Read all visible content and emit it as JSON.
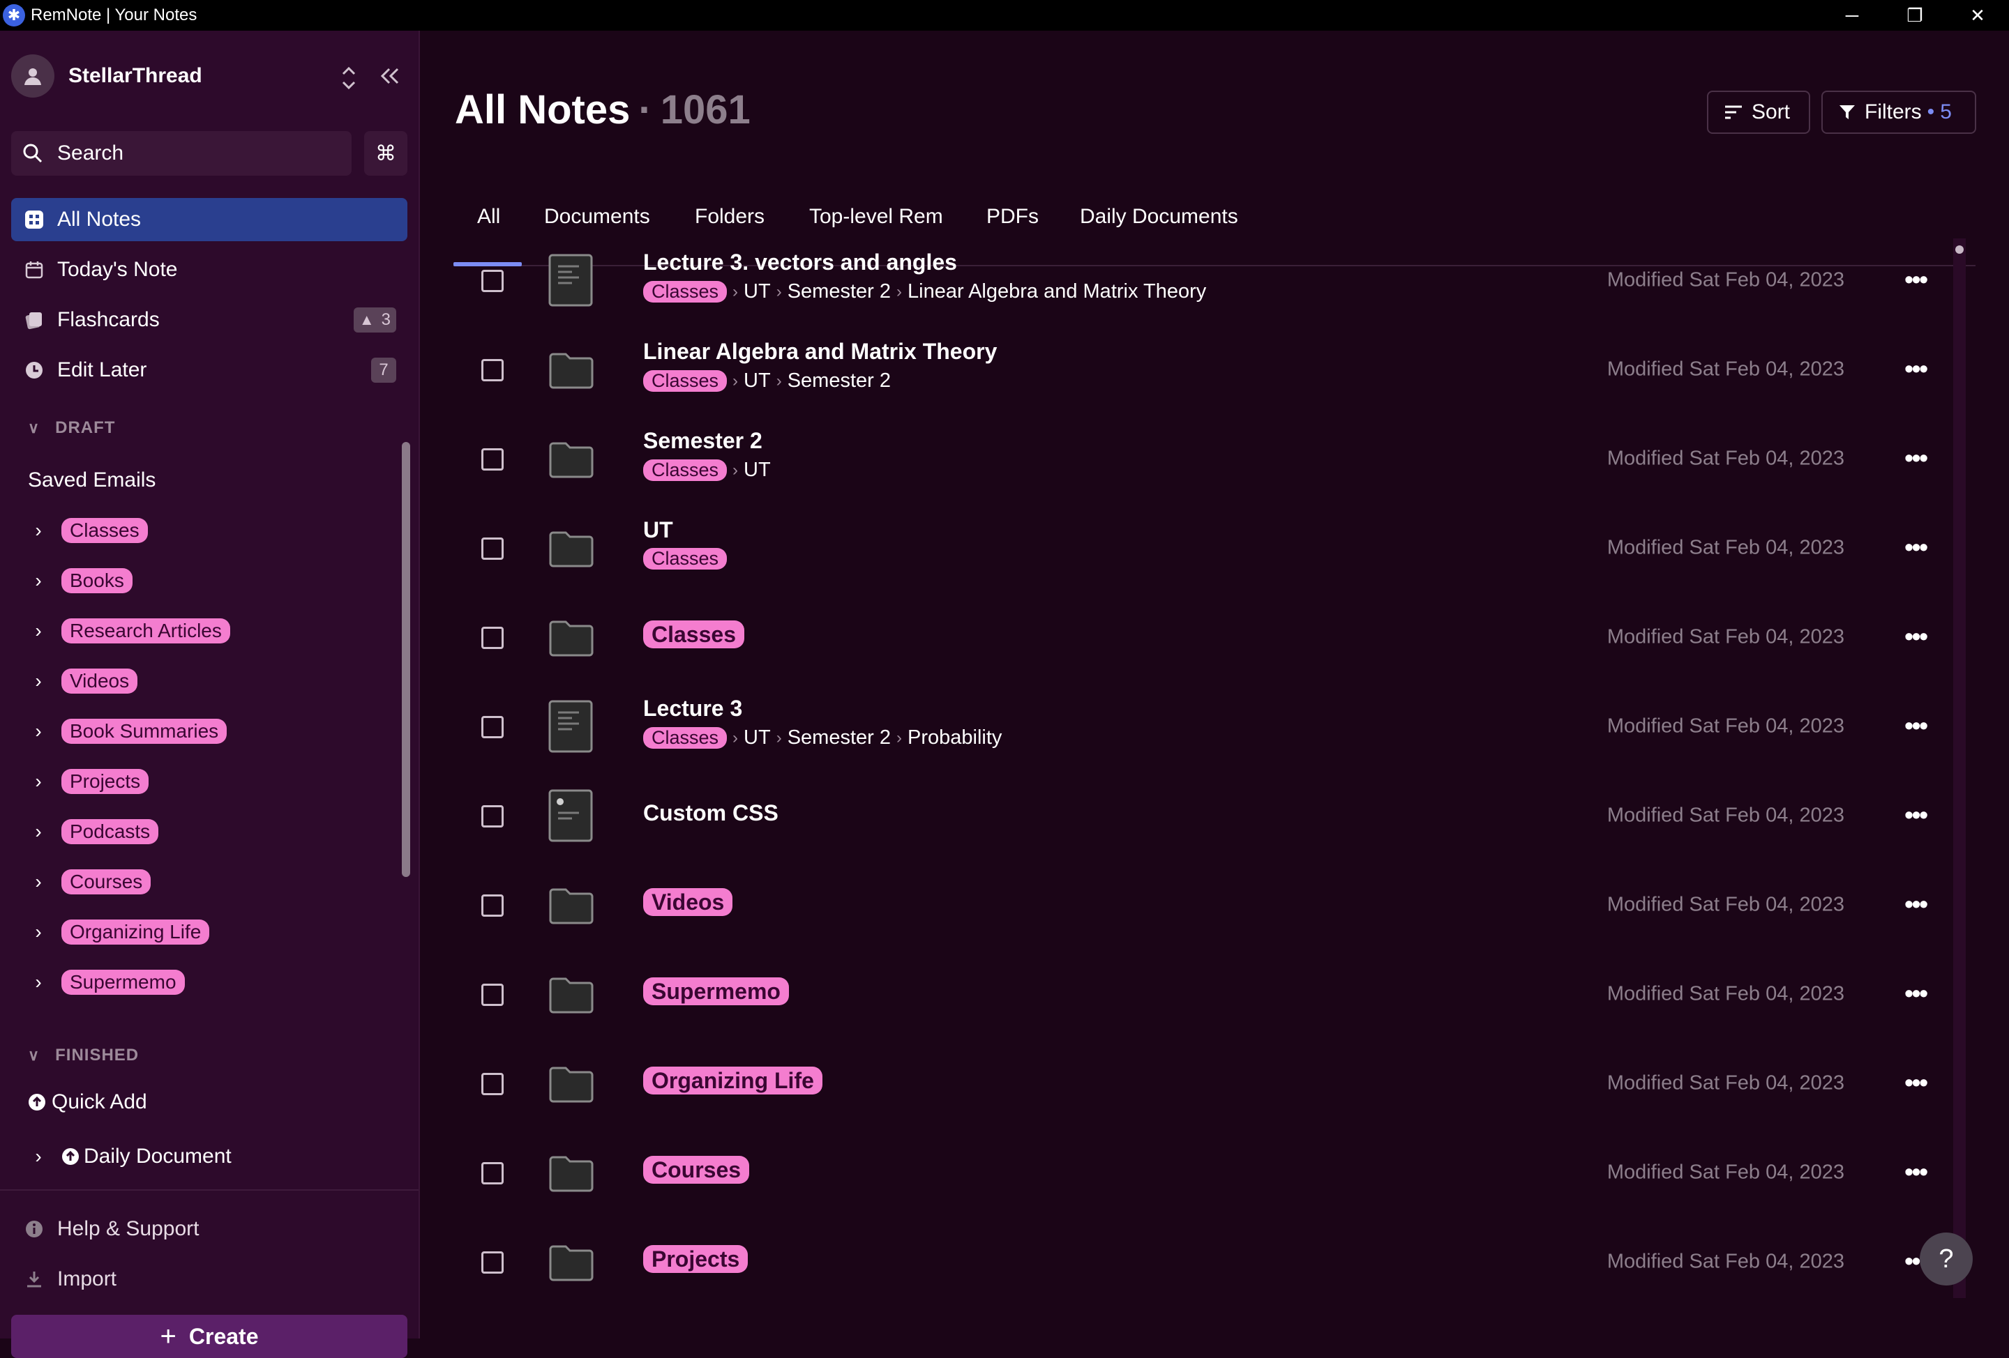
{
  "window": {
    "title": "RemNote | Your Notes",
    "controls": [
      "─",
      "❐",
      "✕"
    ]
  },
  "sidebar": {
    "username": "StellarThread",
    "search_label": "Search",
    "cmd_symbol": "⌘",
    "nav": [
      {
        "label": "All Notes",
        "icon": "grid-icon",
        "active": true
      },
      {
        "label": "Today's Note",
        "icon": "calendar-icon"
      },
      {
        "label": "Flashcards",
        "icon": "cards-icon",
        "badge": "3"
      },
      {
        "label": "Edit Later",
        "icon": "clock-icon",
        "badge": "7"
      }
    ],
    "draft_heading": "DRAFT",
    "saved_emails": "Saved Emails",
    "draft_items": [
      "Classes",
      "Books",
      "Research Articles",
      "Videos",
      "Book Summaries",
      "Projects",
      "Podcasts",
      "Courses",
      "Organizing Life",
      "Supermemo"
    ],
    "finished_heading": "FINISHED",
    "quick_add": "Quick Add",
    "daily_document": "Daily Document",
    "help": "Help & Support",
    "import": "Import",
    "create": "Create"
  },
  "main": {
    "title": "All Notes",
    "count": "1061",
    "sort_label": "Sort",
    "filters_label": "Filters",
    "filters_count": "5",
    "tabs": [
      "All",
      "Documents",
      "Folders",
      "Top-level Rem",
      "PDFs",
      "Daily Documents"
    ],
    "active_tab": "All",
    "help_symbol": "?",
    "rows": [
      {
        "title": "Lecture 3. vectors and angles",
        "type": "document",
        "tag": "Classes",
        "path": [
          "UT",
          "Semester 2",
          "Linear Algebra and Matrix Theory"
        ],
        "modified": "Modified Sat Feb 04, 2023"
      },
      {
        "title": "Linear Algebra and Matrix Theory",
        "type": "folder",
        "tag": "Classes",
        "path": [
          "UT",
          "Semester 2"
        ],
        "modified": "Modified Sat Feb 04, 2023"
      },
      {
        "title": "Semester 2",
        "type": "folder",
        "tag": "Classes",
        "path": [
          "UT"
        ],
        "modified": "Modified Sat Feb 04, 2023"
      },
      {
        "title": "UT",
        "type": "folder",
        "tag": "Classes",
        "path": [],
        "modified": "Modified Sat Feb 04, 2023"
      },
      {
        "title": "Classes",
        "type": "folder",
        "title_is_tag": true,
        "modified": "Modified Sat Feb 04, 2023"
      },
      {
        "title": "Lecture 3",
        "type": "document",
        "tag": "Classes",
        "path": [
          "UT",
          "Semester 2",
          "Probability"
        ],
        "modified": "Modified Sat Feb 04, 2023"
      },
      {
        "title": "Custom CSS",
        "type": "document-dot",
        "modified": "Modified Sat Feb 04, 2023"
      },
      {
        "title": "Videos",
        "type": "folder",
        "title_is_tag": true,
        "modified": "Modified Sat Feb 04, 2023"
      },
      {
        "title": "Supermemo",
        "type": "folder",
        "title_is_tag": true,
        "modified": "Modified Sat Feb 04, 2023"
      },
      {
        "title": "Organizing Life",
        "type": "folder",
        "title_is_tag": true,
        "modified": "Modified Sat Feb 04, 2023"
      },
      {
        "title": "Courses",
        "type": "folder",
        "title_is_tag": true,
        "modified": "Modified Sat Feb 04, 2023"
      },
      {
        "title": "Projects",
        "type": "folder",
        "title_is_tag": true,
        "modified": "Modified Sat Feb 04, 2023"
      }
    ],
    "more_symbol": "•••"
  },
  "colors": {
    "background": "#1b0517",
    "sidebar": "#2d0a2b",
    "active_nav": "#2a3f8f",
    "tag_bg": "#f47dcf",
    "tag_text": "#3a0632",
    "accent_tab": "#7c8cf4",
    "muted_text": "#8d7f8c"
  }
}
